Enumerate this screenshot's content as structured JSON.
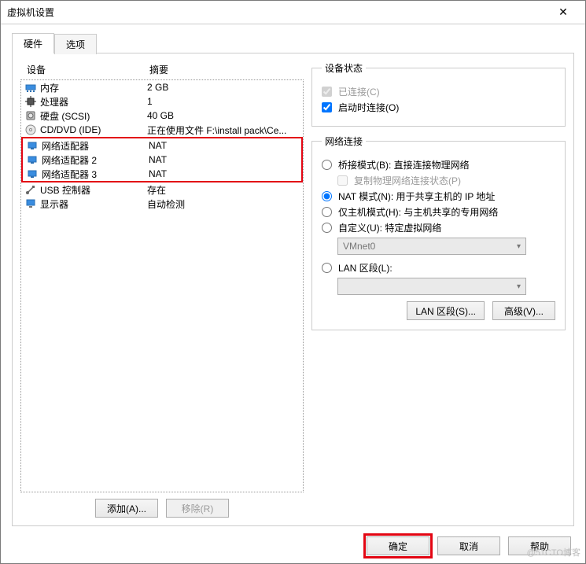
{
  "window": {
    "title": "虚拟机设置",
    "close_label": "✕"
  },
  "tabs": {
    "hardware": "硬件",
    "options": "选项"
  },
  "device_table": {
    "col_device": "设备",
    "col_summary": "摘要",
    "rows": [
      {
        "icon": "memory-icon",
        "label": "内存",
        "summary": "2 GB"
      },
      {
        "icon": "cpu-icon",
        "label": "处理器",
        "summary": "1"
      },
      {
        "icon": "disk-icon",
        "label": "硬盘 (SCSI)",
        "summary": "40 GB"
      },
      {
        "icon": "cd-icon",
        "label": "CD/DVD (IDE)",
        "summary": "正在使用文件 F:\\install pack\\Ce..."
      },
      {
        "icon": "nic-icon",
        "label": "网络适配器",
        "summary": "NAT"
      },
      {
        "icon": "nic-icon",
        "label": "网络适配器 2",
        "summary": "NAT"
      },
      {
        "icon": "nic-icon",
        "label": "网络适配器 3",
        "summary": "NAT"
      },
      {
        "icon": "usb-icon",
        "label": "USB 控制器",
        "summary": "存在"
      },
      {
        "icon": "display-icon",
        "label": "显示器",
        "summary": "自动检测"
      }
    ],
    "add_label": "添加(A)...",
    "remove_label": "移除(R)"
  },
  "device_state": {
    "legend": "设备状态",
    "connected_label": "已连接(C)",
    "connected_checked": true,
    "connected_disabled": true,
    "connect_at_power_on_label": "启动时连接(O)",
    "connect_at_power_on_checked": true
  },
  "network_connection": {
    "legend": "网络连接",
    "bridged_label": "桥接模式(B): 直接连接物理网络",
    "replicate_label": "复制物理网络连接状态(P)",
    "nat_label": "NAT 模式(N): 用于共享主机的 IP 地址",
    "hostonly_label": "仅主机模式(H): 与主机共享的专用网络",
    "custom_label": "自定义(U): 特定虚拟网络",
    "custom_select_value": "VMnet0",
    "lan_segment_label": "LAN 区段(L):",
    "lan_segment_select_value": "",
    "selected": "nat",
    "buttons": {
      "lan_segments": "LAN 区段(S)...",
      "advanced": "高级(V)..."
    }
  },
  "footer": {
    "ok": "确定",
    "cancel": "取消",
    "help": "帮助"
  },
  "watermark": "@51CTO博客"
}
